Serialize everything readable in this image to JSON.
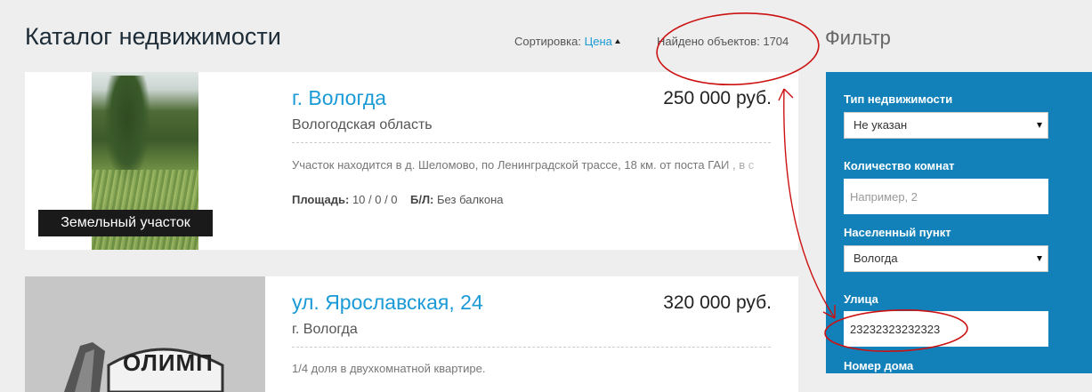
{
  "header": {
    "title": "Каталог недвижимости",
    "sort_label": "Сортировка:",
    "sort_value": "Цена",
    "found_label": "Найдено объектов:",
    "found_count": "1704",
    "filter_title": "Фильтр"
  },
  "listings": [
    {
      "badge": "Земельный участок",
      "title": "г. Вологда",
      "price": "250 000 руб.",
      "region": "Вологодская область",
      "description": "Участок находится в д. Шеломово, по Ленинградской трассе, 18 км. от поста ГАИ , в с",
      "area_label": "Площадь:",
      "area_value": "10 / 0 / 0",
      "balcony_label": "Б/Л:",
      "balcony_value": "Без балкона"
    },
    {
      "logo_text": "ОЛИМП",
      "title": "ул. Ярославская, 24",
      "price": "320 000 руб.",
      "region": "г. Вологда",
      "description": "1/4 доля в двухкомнатной квартире."
    }
  ],
  "filter": {
    "property_type_label": "Тип недвижимости",
    "property_type_value": "Не указан",
    "rooms_label": "Количество комнат",
    "rooms_placeholder": "Например, 2",
    "locality_label": "Населенный пункт",
    "locality_value": "Вологда",
    "street_label": "Улица",
    "street_value": "23232323232323",
    "house_label": "Номер дома"
  },
  "colors": {
    "accent": "#1a9ad6",
    "filter_bg": "#1280b9",
    "annotation": "#cc1111"
  },
  "icons": [
    "sort-asc-icon",
    "select-caret-icon"
  ]
}
